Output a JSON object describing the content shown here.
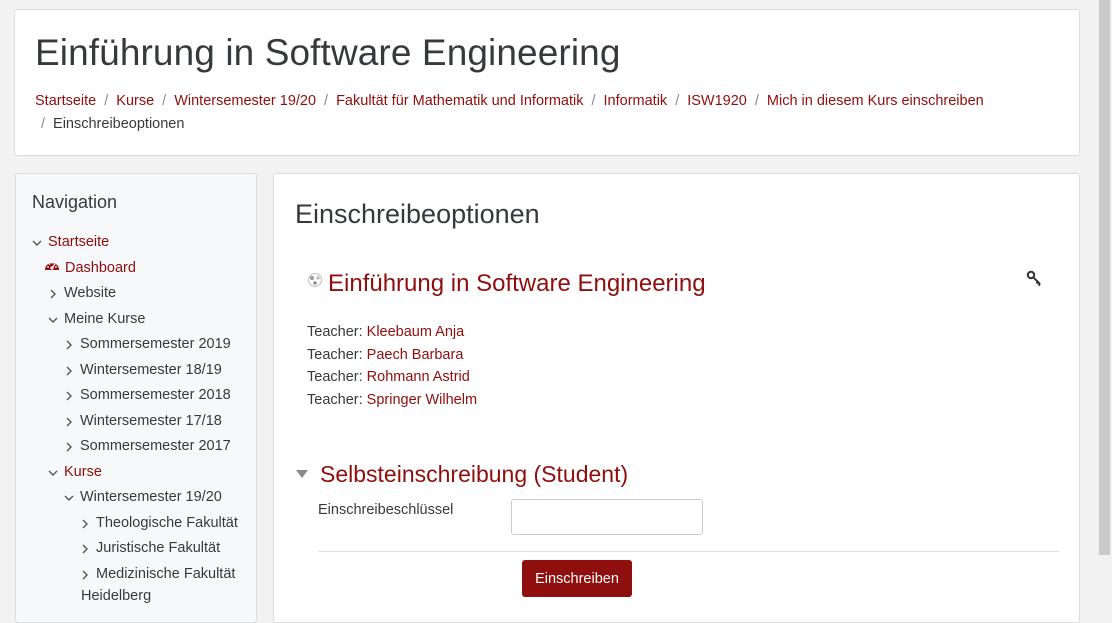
{
  "header": {
    "title": "Einführung in Software Engineering",
    "breadcrumb": [
      {
        "label": "Startseite"
      },
      {
        "label": "Kurse"
      },
      {
        "label": "Wintersemester 19/20"
      },
      {
        "label": "Fakultät für Mathematik und Informatik"
      },
      {
        "label": "Informatik"
      },
      {
        "label": "ISW1920"
      },
      {
        "label": "Mich in diesem Kurs einschreiben"
      },
      {
        "label": "Einschreibeoptionen"
      }
    ]
  },
  "navigation": {
    "title": "Navigation",
    "items": [
      {
        "label": "Startseite"
      },
      {
        "label": "Dashboard"
      },
      {
        "label": "Website"
      },
      {
        "label": "Meine Kurse"
      },
      {
        "label": "Sommersemester 2019"
      },
      {
        "label": "Wintersemester 18/19"
      },
      {
        "label": "Sommersemester 2018"
      },
      {
        "label": "Wintersemester 17/18"
      },
      {
        "label": "Sommersemester 2017"
      },
      {
        "label": "Kurse"
      },
      {
        "label": "Wintersemester 19/20"
      },
      {
        "label": "Theologische Fakultät"
      },
      {
        "label": "Juristische Fakultät"
      },
      {
        "label": "Medizinische Fakultät"
      },
      {
        "label": "Heidelberg"
      }
    ]
  },
  "main": {
    "section_title": "Einschreibeoptionen",
    "course_name": "Einführung in Software Engineering",
    "teachers": [
      {
        "role": "Teacher:",
        "name": "Kleebaum Anja"
      },
      {
        "role": "Teacher:",
        "name": "Paech Barbara"
      },
      {
        "role": "Teacher:",
        "name": "Rohmann Astrid"
      },
      {
        "role": "Teacher:",
        "name": "Springer Wilhelm"
      }
    ],
    "self_enrol": {
      "header": "Selbsteinschreibung (Student)",
      "key_label": "Einschreibeschlüssel",
      "key_value": "",
      "button_label": "Einschreiben"
    }
  },
  "colors": {
    "accent": "#8f0e0e",
    "background": "#f2f2f2",
    "text": "#373a3c"
  }
}
